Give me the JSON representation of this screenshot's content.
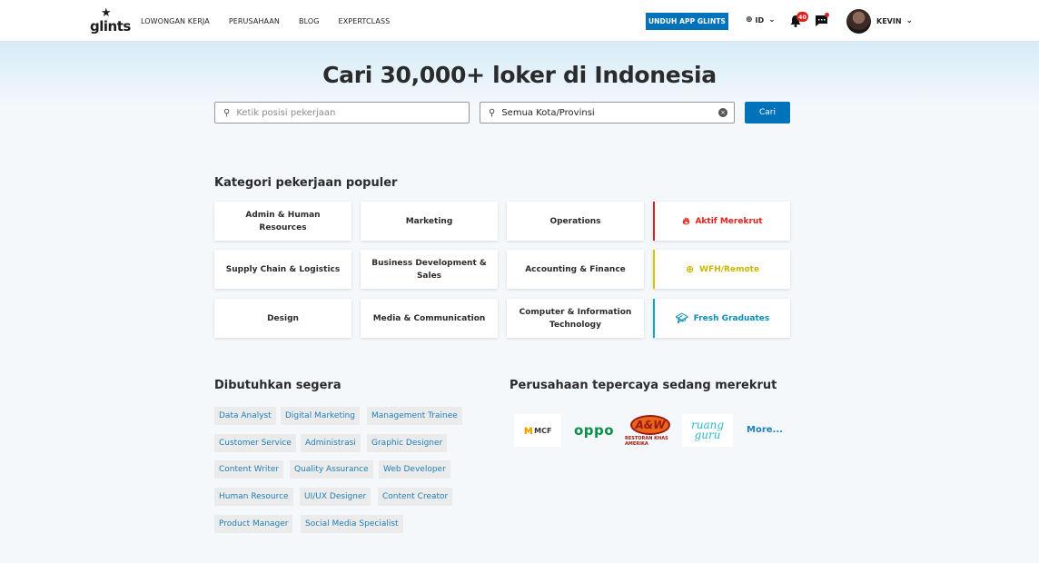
{
  "navbar": {
    "logo_text": "glints",
    "links": [
      "LOWONGAN KERJA",
      "PERUSAHAAN",
      "BLOG",
      "EXPERTCLASS"
    ],
    "app_button": "UNDUH APP GLINTS",
    "language": "ID",
    "notification_count": "40",
    "username": "KEVIN"
  },
  "hero": {
    "title": "Cari 30,000+ loker di Indonesia",
    "search_placeholder": "Ketik posisi pekerjaan",
    "location_value": "Semua Kota/Provinsi",
    "search_button": "Cari"
  },
  "categories": {
    "title": "Kategori pekerjaan populer",
    "items": [
      "Admin & Human Resources",
      "Marketing",
      "Operations",
      "Supply Chain & Logistics",
      "Business Development & Sales",
      "Accounting & Finance",
      "Design",
      "Media & Communication",
      "Computer & Information Technology"
    ],
    "special": [
      {
        "label": "Aktif Merekrut",
        "icon": "fire-icon",
        "color": "#e0201b"
      },
      {
        "label": "WFH/Remote",
        "icon": "globe-icon",
        "color": "#c9b800"
      },
      {
        "label": "Fresh Graduates",
        "icon": "graduation-cap-icon",
        "color": "#0b8fb5"
      }
    ]
  },
  "urgent": {
    "title": "Dibutuhkan segera",
    "tags": [
      "Data Analyst",
      "Digital Marketing",
      "Management Trainee",
      "Customer Service",
      "Administrasi",
      "Graphic Designer",
      "Content Writer",
      "Quality Assurance",
      "Web Developer",
      "Human Resource",
      "UI/UX Designer",
      "Content Creator",
      "Product Manager",
      "Social Media Specialist"
    ]
  },
  "companies": {
    "title": "Perusahaan tepercaya sedang merekrut",
    "logos": {
      "mcf": "MCF",
      "oppo": "oppo",
      "aw": "A&W",
      "aw_sub": "RESTORAN KHAS AMERIKA",
      "ruangguru_1": "ruang",
      "ruangguru_2": "guru"
    },
    "more": "More..."
  }
}
